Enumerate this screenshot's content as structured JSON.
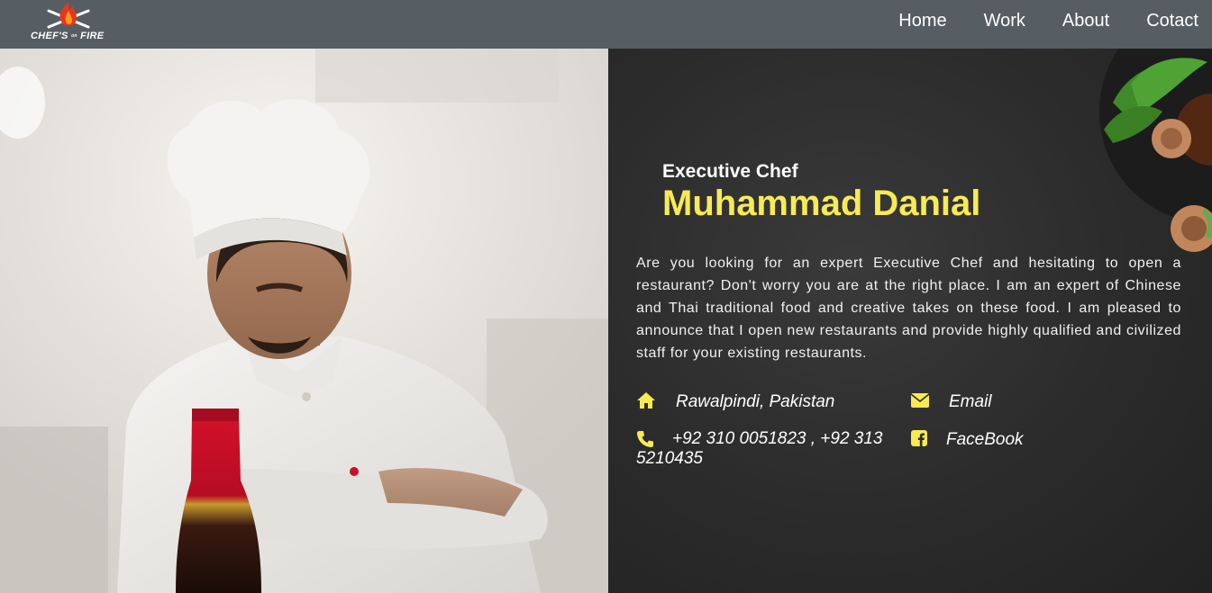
{
  "brand": {
    "logo_text_left": "CHEF'S",
    "logo_text_mid": "on",
    "logo_text_right": "FIRE"
  },
  "nav": {
    "items": [
      {
        "label": "Home"
      },
      {
        "label": "Work"
      },
      {
        "label": "About"
      },
      {
        "label": "Cotact"
      }
    ]
  },
  "hero": {
    "role": "Executive Chef",
    "name": "Muhammad Danial",
    "bio": "Are you looking for an expert Executive Chef and hesitating to open a restaurant? Don't worry you are at the right place. I am an expert of Chinese and Thai traditional food and creative takes on these food. I am pleased to announce that I open new restaurants and provide highly qualified and civilized staff for your existing restaurants."
  },
  "contact": {
    "address": "Rawalpindi, Pakistan",
    "email": "Email",
    "phone": "+92 310 0051823 , +92 313 5210435",
    "facebook": "FaceBook"
  },
  "icons": {
    "address": "home-icon",
    "email": "envelope-icon",
    "phone": "phone-icon",
    "facebook": "facebook-square-icon"
  },
  "colors": {
    "navbar": "#565d63",
    "accent": "#f7ea55",
    "panel": "#2b2b2b",
    "text": "#ffffff"
  }
}
